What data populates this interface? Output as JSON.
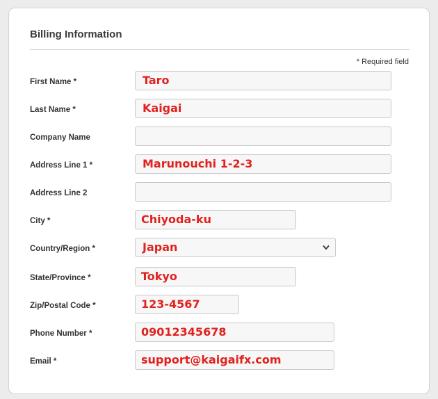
{
  "form": {
    "title": "Billing Information",
    "required_note": "* Required field",
    "fields": {
      "first_name": {
        "label": "First Name *",
        "value": "Taro"
      },
      "last_name": {
        "label": "Last Name *",
        "value": "Kaigai"
      },
      "company": {
        "label": "Company Name",
        "value": ""
      },
      "address1": {
        "label": "Address Line 1 *",
        "value": "Marunouchi 1-2-3"
      },
      "address2": {
        "label": "Address Line 2",
        "value": ""
      },
      "city": {
        "label": "City *",
        "value": "Chiyoda-ku"
      },
      "country": {
        "label": "Country/Region *",
        "value": "Japan"
      },
      "state": {
        "label": "State/Province *",
        "value": "Tokyo"
      },
      "zip": {
        "label": "Zip/Postal Code *",
        "value": "123-4567"
      },
      "phone": {
        "label": "Phone Number *",
        "value": "09012345678"
      },
      "email": {
        "label": "Email *",
        "value": "support@kaigaifx.com"
      }
    }
  },
  "colors": {
    "value_text": "#e0221f",
    "label_text": "#333333",
    "field_bg": "#f7f7f7",
    "page_bg": "#ececec"
  },
  "icons": {
    "select_arrow": "chevron-down-icon"
  }
}
